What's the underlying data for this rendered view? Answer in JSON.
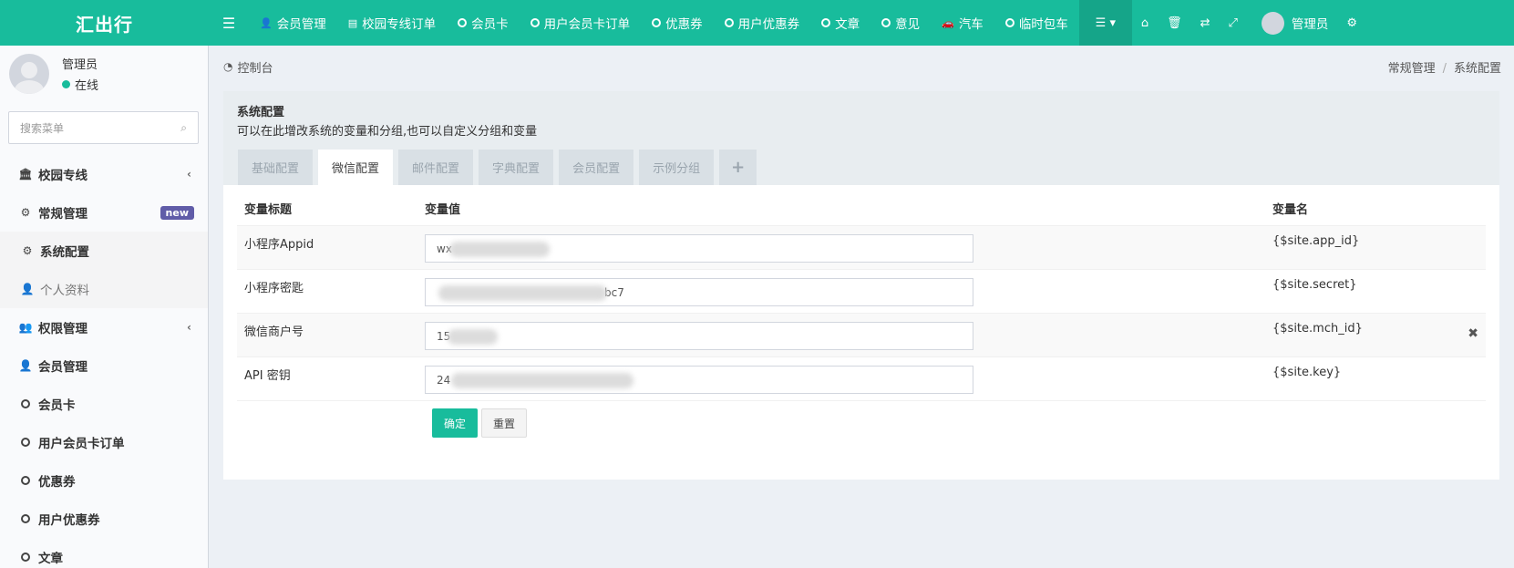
{
  "app": {
    "logo": "汇出行"
  },
  "topnav": [
    {
      "label": "会员管理",
      "icon": "user-icon"
    },
    {
      "label": "校园专线订单",
      "icon": "list-icon"
    },
    {
      "label": "会员卡",
      "icon": "circle-icon"
    },
    {
      "label": "用户会员卡订单",
      "icon": "circle-icon"
    },
    {
      "label": "优惠券",
      "icon": "circle-icon"
    },
    {
      "label": "用户优惠券",
      "icon": "circle-icon"
    },
    {
      "label": "文章",
      "icon": "circle-icon"
    },
    {
      "label": "意见",
      "icon": "circle-icon"
    },
    {
      "label": "汽车",
      "icon": "car-icon"
    },
    {
      "label": "临时包车",
      "icon": "circle-icon"
    }
  ],
  "topright": {
    "user_name": "管理员"
  },
  "sidebar": {
    "user": {
      "name": "管理员",
      "status": "在线"
    },
    "search": {
      "placeholder": "搜索菜单"
    },
    "items": [
      {
        "label": "校园专线",
        "icon": "bank-icon"
      },
      {
        "label": "常规管理",
        "icon": "cogs-icon",
        "badge": "new"
      },
      {
        "label": "系统配置",
        "icon": "gear-icon"
      },
      {
        "label": "个人资料",
        "icon": "user-icon"
      },
      {
        "label": "权限管理",
        "icon": "group-icon"
      },
      {
        "label": "会员管理",
        "icon": "user-icon"
      },
      {
        "label": "会员卡",
        "icon": "circle-icon"
      },
      {
        "label": "用户会员卡订单",
        "icon": "circle-icon"
      },
      {
        "label": "优惠券",
        "icon": "circle-icon"
      },
      {
        "label": "用户优惠券",
        "icon": "circle-icon"
      },
      {
        "label": "文章",
        "icon": "circle-icon"
      }
    ]
  },
  "breadcrumb": {
    "home": "控制台",
    "path1": "常规管理",
    "path2": "系统配置"
  },
  "panel": {
    "title": "系统配置",
    "desc": "可以在此增改系统的变量和分组,也可以自定义分组和变量",
    "tabs": [
      "基础配置",
      "微信配置",
      "邮件配置",
      "字典配置",
      "会员配置",
      "示例分组"
    ],
    "active_tab": "微信配置"
  },
  "table": {
    "headers": {
      "title": "变量标题",
      "value": "变量值",
      "name": "变量名"
    },
    "rows": [
      {
        "title": "小程序Appid",
        "value": "wx",
        "name": "{$site.app_id}"
      },
      {
        "title": "小程序密匙",
        "value": "bc7",
        "name": "{$site.secret}"
      },
      {
        "title": "微信商户号",
        "value": "15",
        "name": "{$site.mch_id}"
      },
      {
        "title": "API 密钥",
        "value": "24",
        "name": "{$site.key}"
      }
    ]
  },
  "buttons": {
    "ok": "确定",
    "reset": "重置"
  },
  "colors": {
    "primary": "#18bc9c",
    "badge": "#605ca8"
  }
}
